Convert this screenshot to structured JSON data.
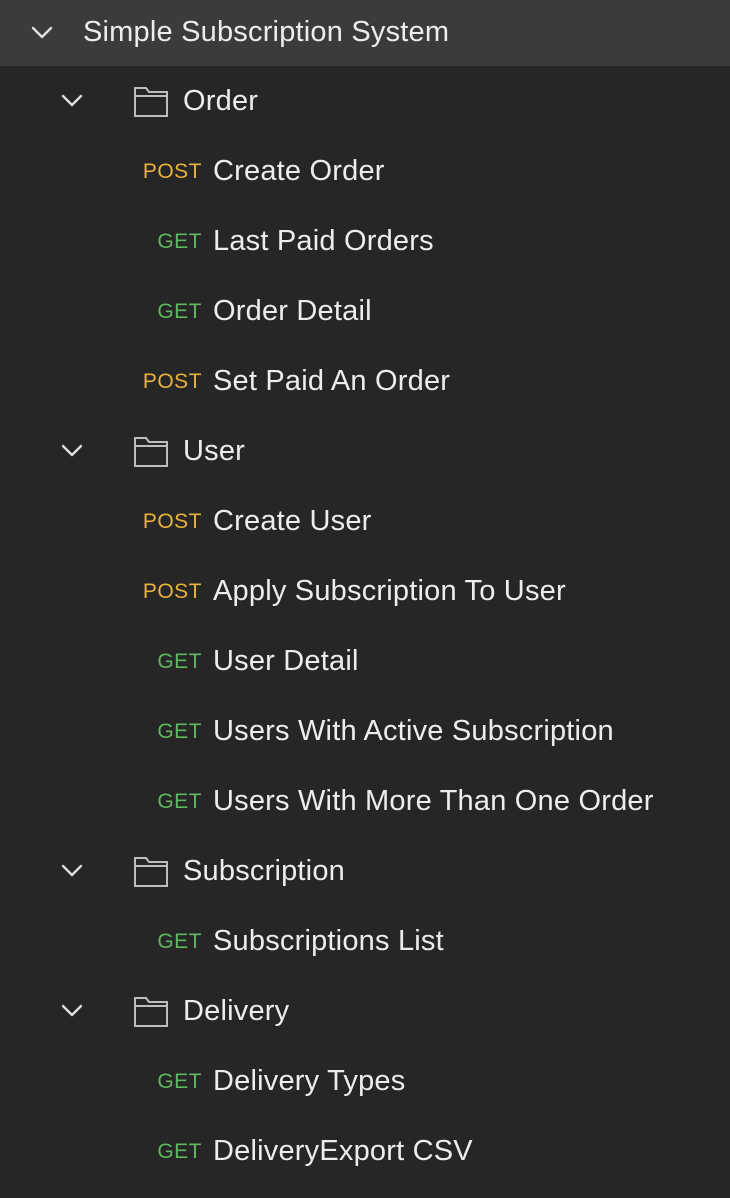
{
  "collection": {
    "name": "Simple Subscription System",
    "expanded": true
  },
  "colors": {
    "background": "#262626",
    "collection_header_bg": "#3b3b3b",
    "post_method": "#e8b33c",
    "get_method": "#5fb85f",
    "text": "#ededed",
    "icon": "#bdbdbd"
  },
  "folders": [
    {
      "name": "Order",
      "expanded": true,
      "requests": [
        {
          "method": "POST",
          "name": "Create Order"
        },
        {
          "method": "GET",
          "name": "Last Paid Orders"
        },
        {
          "method": "GET",
          "name": "Order Detail"
        },
        {
          "method": "POST",
          "name": "Set Paid An Order"
        }
      ]
    },
    {
      "name": "User",
      "expanded": true,
      "requests": [
        {
          "method": "POST",
          "name": "Create User"
        },
        {
          "method": "POST",
          "name": "Apply Subscription To User"
        },
        {
          "method": "GET",
          "name": "User Detail"
        },
        {
          "method": "GET",
          "name": "Users With Active Subscription"
        },
        {
          "method": "GET",
          "name": "Users With More Than One Order"
        }
      ]
    },
    {
      "name": "Subscription",
      "expanded": true,
      "requests": [
        {
          "method": "GET",
          "name": "Subscriptions List"
        }
      ]
    },
    {
      "name": "Delivery",
      "expanded": true,
      "requests": [
        {
          "method": "GET",
          "name": "Delivery Types"
        },
        {
          "method": "GET",
          "name": "DeliveryExport CSV"
        }
      ]
    }
  ]
}
